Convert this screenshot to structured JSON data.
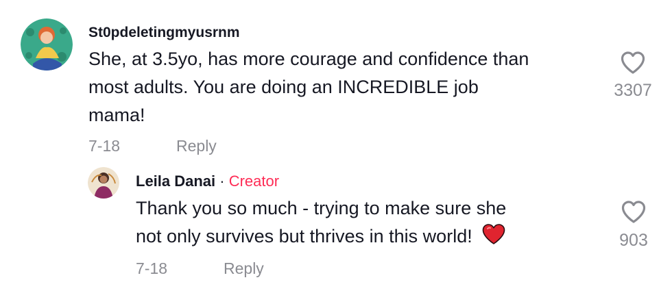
{
  "comment": {
    "username": "St0pdeletingmyusrnm",
    "text_lines": [
      "She, at 3.5yo, has more courage and confidence than",
      "most adults. You are doing an INCREDIBLE job",
      "mama!"
    ],
    "date": "7-18",
    "reply_label": "Reply",
    "likes": "3307"
  },
  "reply": {
    "username": "Leila Danai",
    "separator": " · ",
    "badge": "Creator",
    "text_lines": [
      "Thank you so much - trying to make sure she",
      "not only survives but thrives in this world!"
    ],
    "emoji": "red-heart",
    "date": "7-18",
    "reply_label": "Reply",
    "likes": "903"
  },
  "icons": {
    "like": "heart-outline-icon",
    "emoji": "red-heart-emoji"
  },
  "colors": {
    "text": "#161823",
    "muted": "#8a8b91",
    "creator": "#fe2c55",
    "heart_emoji": "#e0242f"
  }
}
